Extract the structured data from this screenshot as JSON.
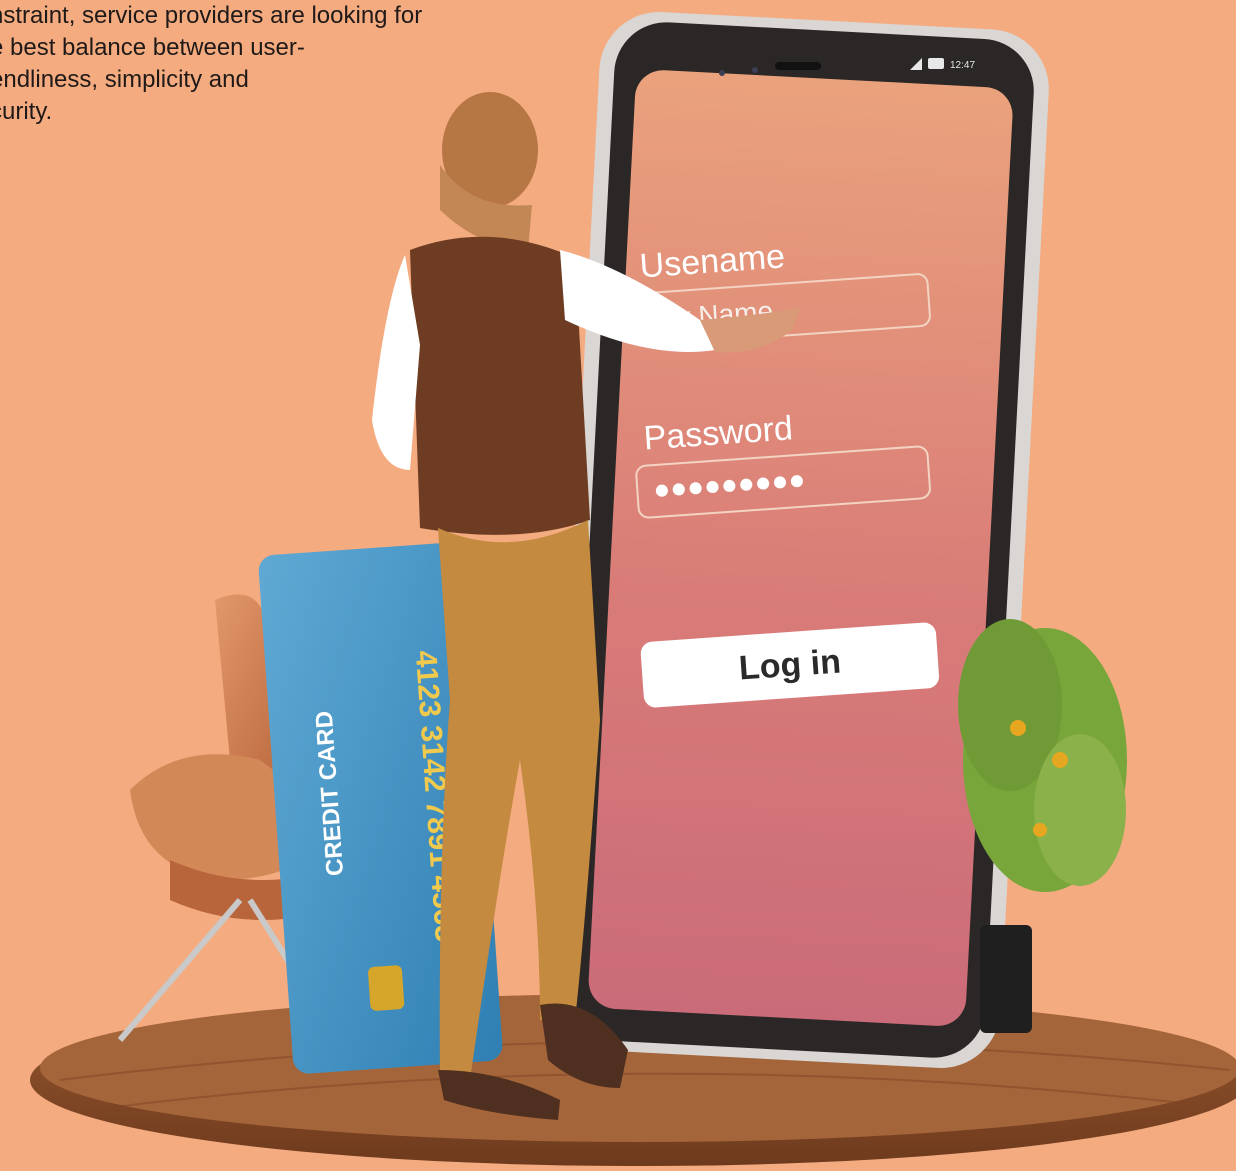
{
  "intro": {
    "lines": [
      "nstraint, service providers are looking for",
      "e best balance between user-",
      "endliness, simplicity and",
      "curity."
    ]
  },
  "phone": {
    "status_time": "12:47",
    "screen_gradient": [
      "#eaa27c",
      "#d97c78",
      "#ca6b79"
    ],
    "username_label": "Usename",
    "username_value": "My Name",
    "password_label": "Password",
    "password_mask": "●●●●●●●●●",
    "login_button": "Log in"
  },
  "credit_card": {
    "label": "CREDIT CARD",
    "number": "4123 3142 7891 4563",
    "color": "#3f8dbf"
  },
  "colors": {
    "background": "#f4ab80",
    "platform": "#8a4a27",
    "vest": "#6e3c22",
    "pants": "#c48a3f"
  },
  "icons": {
    "signal": "signal-icon",
    "battery": "battery-icon",
    "chip": "card-chip-icon"
  }
}
